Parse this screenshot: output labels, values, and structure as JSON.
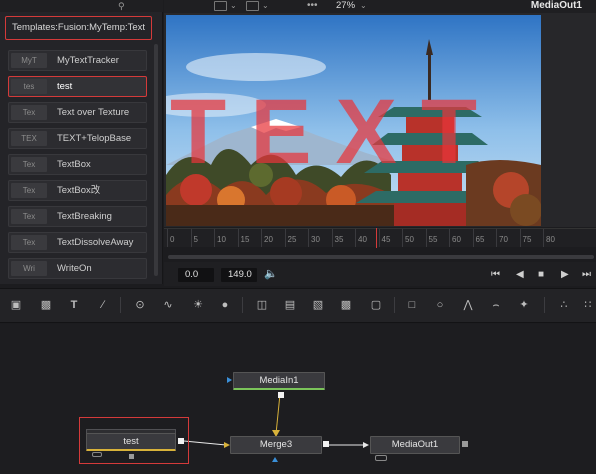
{
  "left_panel": {
    "path": "Templates:Fusion:MyTemp:Text",
    "items": [
      {
        "thumb": "MyT",
        "label": "MyTextTracker",
        "selected": false
      },
      {
        "thumb": "tes",
        "label": "test",
        "selected": true
      },
      {
        "thumb": "Tex",
        "label": "Text over Texture",
        "selected": false
      },
      {
        "thumb": "TEX",
        "label": "TEXT+TelopBase",
        "selected": false
      },
      {
        "thumb": "Tex",
        "label": "TextBox",
        "selected": false
      },
      {
        "thumb": "Tex",
        "label": "TextBox改",
        "selected": false
      },
      {
        "thumb": "Tex",
        "label": "TextBreaking",
        "selected": false
      },
      {
        "thumb": "Tex",
        "label": "TextDissolveAway",
        "selected": false
      },
      {
        "thumb": "Wri",
        "label": "WriteOn",
        "selected": false
      }
    ]
  },
  "viewer": {
    "zoom": "27%",
    "title": "MediaOut1",
    "overlay_text": "TEXT"
  },
  "timeline": {
    "ticks": [
      "0",
      "5",
      "10",
      "15",
      "20",
      "25",
      "30",
      "35",
      "40",
      "45",
      "50",
      "55",
      "60",
      "65",
      "70",
      "75",
      "80"
    ],
    "start_time": "0.0",
    "end_time": "149.0",
    "playhead_frame": 41
  },
  "nodes": {
    "media_in": "MediaIn1",
    "test": "test",
    "merge": "Merge3",
    "media_out": "MediaOut1"
  },
  "colors": {
    "highlight_red": "#d43a3a",
    "node_green": "#7bc45a",
    "link_yellow": "#d8b23a",
    "text_overlay": "#e8343a"
  }
}
